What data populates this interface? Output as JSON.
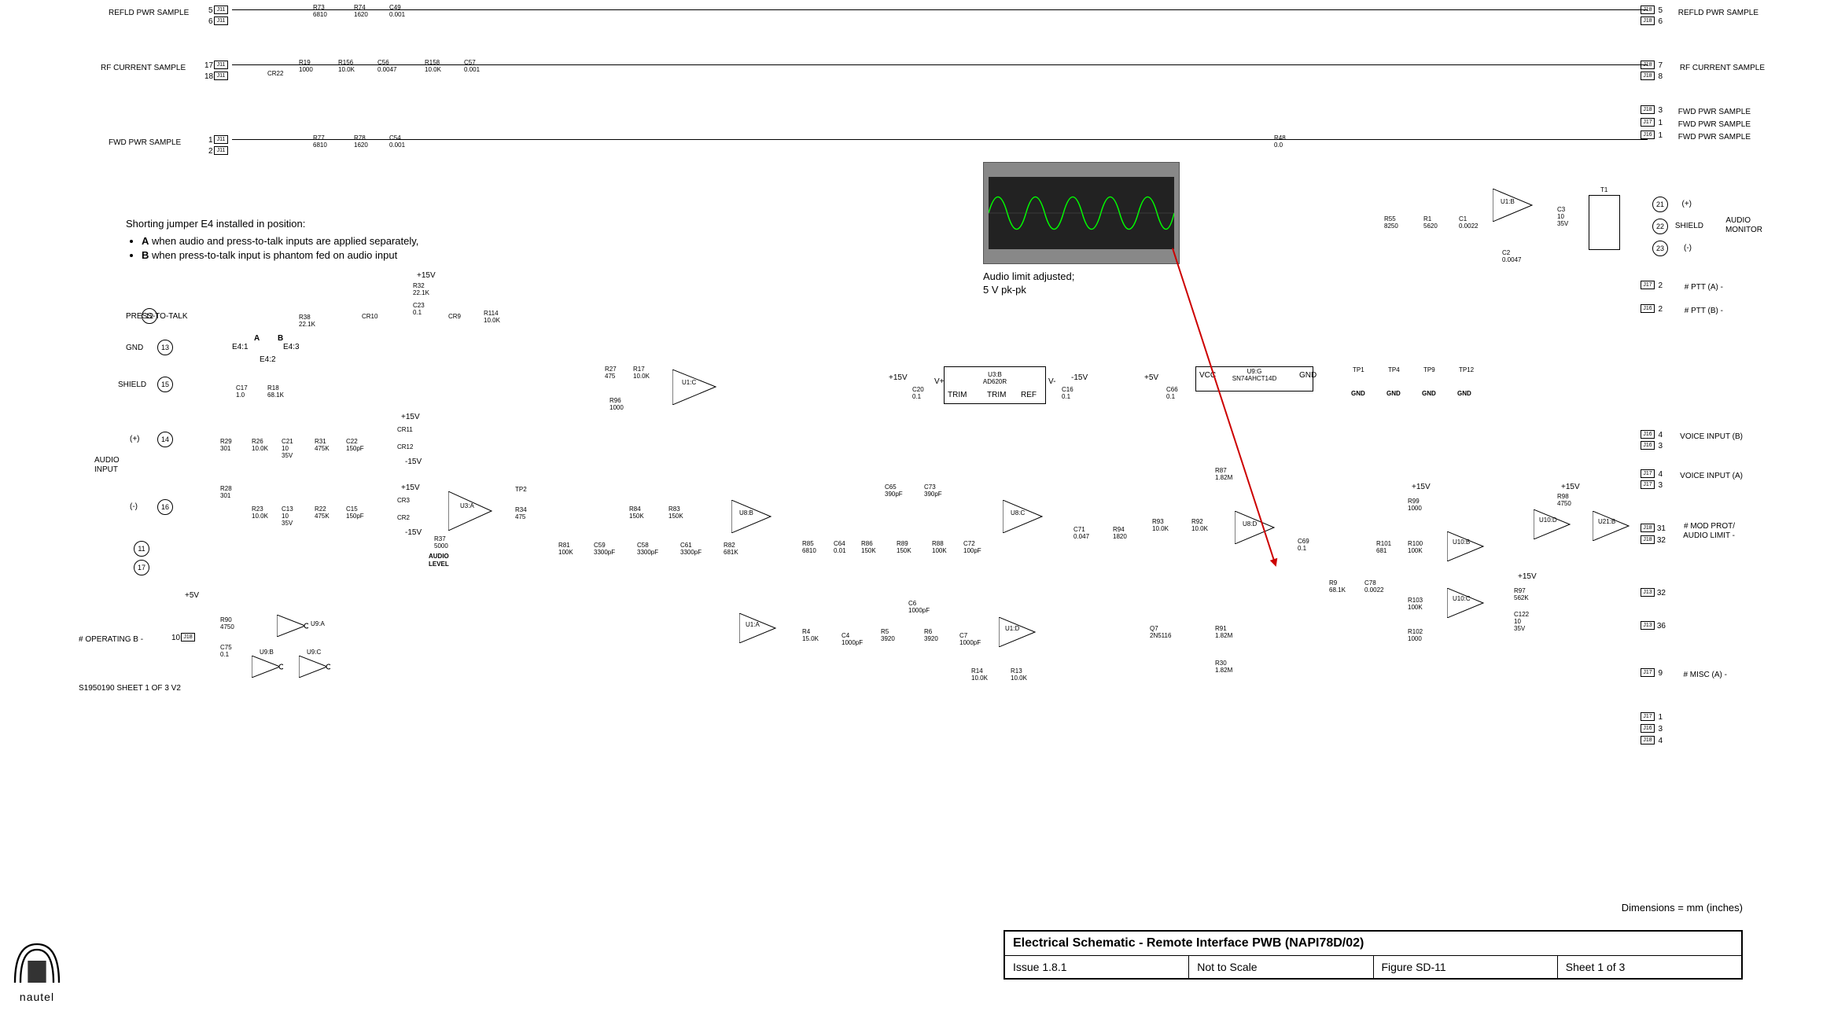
{
  "title_block": {
    "title": "Electrical Schematic - Remote Interface PWB (NAPI78D/02)",
    "issue": "Issue 1.8.1",
    "scale": "Not to Scale",
    "figure": "Figure SD-11",
    "sheet": "Sheet 1 of 3"
  },
  "dimensions_note": "Dimensions = mm (inches)",
  "logo_text": "nautel",
  "sheet_id": "S1950190   SHEET 1 OF 3   V2",
  "jumper_note": {
    "heading": "Shorting jumper E4 installed in position:",
    "bullet_a_prefix": "A",
    "bullet_a_text": " when audio and press-to-talk inputs are applied separately,",
    "bullet_b_prefix": "B",
    "bullet_b_text": " when press-to-talk input is phantom fed on audio input"
  },
  "scope_caption_l1": "Audio limit adjusted;",
  "scope_caption_l2": "5 V pk-pk",
  "audio_level_label": "AUDIO",
  "audio_level_label2": "LEVEL",
  "signals_left": {
    "refld_pwr": "REFLD PWR SAMPLE",
    "rf_current": "RF CURRENT SAMPLE",
    "fwd_pwr": "FWD PWR SAMPLE",
    "press_to_talk": "PRESS-TO-TALK",
    "gnd": "GND",
    "shield": "SHIELD",
    "audio_input": "AUDIO",
    "audio_input2": "INPUT",
    "plus": "(+)",
    "minus": "(-)",
    "operating_b": "# OPERATING B -"
  },
  "signals_right": {
    "refld_pwr": "REFLD PWR SAMPLE",
    "rf_current": "RF CURRENT SAMPLE",
    "fwd_pwr": "FWD PWR SAMPLE",
    "audio_monitor": "AUDIO",
    "audio_monitor2": "MONITOR",
    "plus": "(+)",
    "shield": "SHIELD",
    "minus": "(-)",
    "ptt_a": "# PTT (A) -",
    "ptt_b": "# PTT (B) -",
    "voice_b": "VOICE INPUT (B)",
    "voice_a": "VOICE INPUT (A)",
    "mod_prot1": "# MOD PROT/",
    "mod_prot2": "AUDIO LIMIT -",
    "misc_a": "# MISC (A) -"
  },
  "jumper_labels": {
    "a": "A",
    "b": "B",
    "e41": "E4:1",
    "e42": "E4:2",
    "e43": "E4:3"
  },
  "tp_labels": {
    "tp1": "TP1",
    "tp4": "TP4",
    "tp9": "TP9",
    "tp12": "TP12",
    "gnd": "GND",
    "tp2": "TP2"
  },
  "voltages": {
    "p15": "+15V",
    "n15": "-15V",
    "p5": "+5V"
  },
  "ics": {
    "u1a": "U1:A",
    "u1b": "U1:B",
    "u1c": "U1:C",
    "u1d": "U1:D",
    "u3a": "U3:A",
    "u3b": "U3:B",
    "u3b_part": "AD620R",
    "u8b": "U8:B",
    "u8c": "U8:C",
    "u8d": "U8:D",
    "u9a": "U9:A",
    "u9b": "U9:B",
    "u9c": "U9:C",
    "u9g": "U9:G",
    "u9g_part": "SN74AHCT14D",
    "u10b": "U10:B",
    "u10c": "U10:C",
    "u10d": "U10:D",
    "u21b": "U21:B",
    "vcc": "VCC",
    "gnd_pin": "GND",
    "trim": "TRIM",
    "ref": "REF",
    "vplus": "V+",
    "vminus": "V-"
  },
  "connectors": {
    "j11": "J11",
    "j16": "J16",
    "j17": "J17",
    "j18": "J18",
    "j13": "J13"
  },
  "pins_left": {
    "p5": "5",
    "p6": "6",
    "p17": "17",
    "p18": "18",
    "p1": "1",
    "p2": "2",
    "p12": "12",
    "p13": "13",
    "p15": "15",
    "p14": "14",
    "p16": "16",
    "p11": "11",
    "p17b": "17",
    "p10": "10"
  },
  "pins_right": {
    "p5": "5",
    "p6": "6",
    "p7": "7",
    "p8": "8",
    "p3": "3",
    "p1": "1",
    "p21": "21",
    "p22": "22",
    "p23": "23",
    "p2": "2",
    "p4": "4",
    "p31": "31",
    "p32": "32",
    "p36": "36",
    "p9": "9",
    "p1b": "1",
    "p3b": "3",
    "p4b": "4"
  },
  "components": {
    "r73": {
      "ref": "R73",
      "val": "6810"
    },
    "r74": {
      "ref": "R74",
      "val": "1620"
    },
    "c49": {
      "ref": "C49",
      "val": "0.001"
    },
    "cr22": {
      "ref": "CR22",
      "val": ""
    },
    "r19": {
      "ref": "R19",
      "val": "1000"
    },
    "r156": {
      "ref": "R156",
      "val": "10.0K"
    },
    "c56": {
      "ref": "C56",
      "val": "0.0047"
    },
    "r158": {
      "ref": "R158",
      "val": "10.0K"
    },
    "c57": {
      "ref": "C57",
      "val": "0.001"
    },
    "r77": {
      "ref": "R77",
      "val": "6810"
    },
    "r78": {
      "ref": "R78",
      "val": "1620"
    },
    "c54": {
      "ref": "C54",
      "val": "0.001"
    },
    "r48": {
      "ref": "R48",
      "val": "0.0"
    },
    "r32": {
      "ref": "R32",
      "val": "22.1K"
    },
    "c23": {
      "ref": "C23",
      "val": "0.1"
    },
    "r38": {
      "ref": "R38",
      "val": "22.1K"
    },
    "cr10": {
      "ref": "CR10",
      "val": ""
    },
    "cr9": {
      "ref": "CR9",
      "val": ""
    },
    "r114": {
      "ref": "R114",
      "val": "10.0K"
    },
    "c17": {
      "ref": "C17",
      "val": "1.0"
    },
    "r18": {
      "ref": "R18",
      "val": "68.1K"
    },
    "r29": {
      "ref": "R29",
      "val": "301"
    },
    "r26": {
      "ref": "R26",
      "val": "10.0K"
    },
    "c21": {
      "ref": "C21",
      "val": "10\n35V"
    },
    "r31": {
      "ref": "R31",
      "val": "475K"
    },
    "c22": {
      "ref": "C22",
      "val": "150pF"
    },
    "cr11": {
      "ref": "CR11",
      "val": ""
    },
    "cr12": {
      "ref": "CR12",
      "val": ""
    },
    "r28": {
      "ref": "R28",
      "val": "301"
    },
    "r23": {
      "ref": "R23",
      "val": "10.0K"
    },
    "c13": {
      "ref": "C13",
      "val": "10\n35V"
    },
    "r22": {
      "ref": "R22",
      "val": "475K"
    },
    "c15": {
      "ref": "C15",
      "val": "150pF"
    },
    "cr3": {
      "ref": "CR3",
      "val": ""
    },
    "cr2": {
      "ref": "CR2",
      "val": ""
    },
    "r37": {
      "ref": "R37",
      "val": "5000"
    },
    "r34": {
      "ref": "R34",
      "val": "475"
    },
    "r27": {
      "ref": "R27",
      "val": "475"
    },
    "r17": {
      "ref": "R17",
      "val": "10.0K"
    },
    "r96": {
      "ref": "R96",
      "val": "1000"
    },
    "c20": {
      "ref": "C20",
      "val": "0.1"
    },
    "c16": {
      "ref": "C16",
      "val": "0.1"
    },
    "c66": {
      "ref": "C66",
      "val": "0.1"
    },
    "r81": {
      "ref": "R81",
      "val": "100K"
    },
    "c59": {
      "ref": "C59",
      "val": "3300pF"
    },
    "c58": {
      "ref": "C58",
      "val": "3300pF"
    },
    "c61": {
      "ref": "C61",
      "val": "3300pF"
    },
    "r82": {
      "ref": "R82",
      "val": "681K"
    },
    "r84": {
      "ref": "R84",
      "val": "150K"
    },
    "r83": {
      "ref": "R83",
      "val": "150K"
    },
    "r85": {
      "ref": "R85",
      "val": "6810"
    },
    "c64": {
      "ref": "C64",
      "val": "0.01"
    },
    "r86": {
      "ref": "R86",
      "val": "150K"
    },
    "r89": {
      "ref": "R89",
      "val": "150K"
    },
    "r88": {
      "ref": "R88",
      "val": "100K"
    },
    "c72": {
      "ref": "C72",
      "val": "100pF"
    },
    "c65": {
      "ref": "C65",
      "val": "390pF"
    },
    "c73": {
      "ref": "C73",
      "val": "390pF"
    },
    "c71": {
      "ref": "C71",
      "val": "0.047"
    },
    "r94": {
      "ref": "R94",
      "val": "1820"
    },
    "r93": {
      "ref": "R93",
      "val": "10.0K"
    },
    "r92": {
      "ref": "R92",
      "val": "10.0K"
    },
    "r87": {
      "ref": "R87",
      "val": "1.82M"
    },
    "c69": {
      "ref": "C69",
      "val": "0.1"
    },
    "q7": {
      "ref": "Q7",
      "val": "2N5116"
    },
    "r91": {
      "ref": "R91",
      "val": "1.82M"
    },
    "r30": {
      "ref": "R30",
      "val": "1.82M"
    },
    "r4": {
      "ref": "R4",
      "val": "15.0K"
    },
    "c4": {
      "ref": "C4",
      "val": "1000pF"
    },
    "r5": {
      "ref": "R5",
      "val": "3920"
    },
    "r6": {
      "ref": "R6",
      "val": "3920"
    },
    "c7": {
      "ref": "C7",
      "val": "1000pF"
    },
    "c6": {
      "ref": "C6",
      "val": "1000pF"
    },
    "r14": {
      "ref": "R14",
      "val": "10.0K"
    },
    "r13": {
      "ref": "R13",
      "val": "10.0K"
    },
    "r90": {
      "ref": "R90",
      "val": "4750"
    },
    "c75": {
      "ref": "C75",
      "val": "0.1"
    },
    "r55": {
      "ref": "R55",
      "val": "8250"
    },
    "r1": {
      "ref": "R1",
      "val": "5620"
    },
    "c1": {
      "ref": "C1",
      "val": "0.0022"
    },
    "c2": {
      "ref": "C2",
      "val": "0.0047"
    },
    "c3": {
      "ref": "C3",
      "val": "10\n35V"
    },
    "t1": {
      "ref": "T1",
      "val": ""
    },
    "r99": {
      "ref": "R99",
      "val": "1000"
    },
    "r101": {
      "ref": "R101",
      "val": "681"
    },
    "r100": {
      "ref": "R100",
      "val": "100K"
    },
    "r9": {
      "ref": "R9",
      "val": "68.1K"
    },
    "c78": {
      "ref": "C78",
      "val": "0.0022"
    },
    "r103": {
      "ref": "R103",
      "val": "100K"
    },
    "r102": {
      "ref": "R102",
      "val": "1000"
    },
    "c122": {
      "ref": "C122",
      "val": "10\n35V"
    },
    "r97": {
      "ref": "R97",
      "val": "562K"
    },
    "r98": {
      "ref": "R98",
      "val": "4750"
    }
  }
}
